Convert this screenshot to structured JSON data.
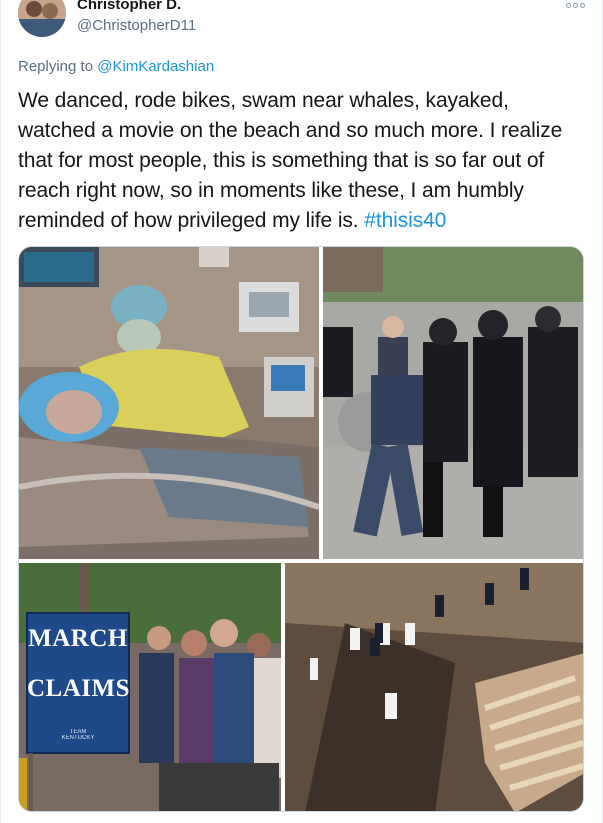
{
  "author": {
    "display_name": "Christopher D.",
    "handle": "@ChristopherD11"
  },
  "reply": {
    "prefix": "Replying to",
    "mention": "@KimKardashian"
  },
  "tweet": {
    "text": "We danced, rode bikes, swam near whales, kayaked, watched a movie on the beach and so much more. I realize that for most people, this is something that is so far out of reach right now, so in moments like these, I am humbly reminded of how privileged my life is.",
    "hashtag": "#thisis40"
  },
  "media": {
    "sign_line1": "MARCH",
    "sign_line2": "CLAIMS",
    "sign_footer1": "TEAM",
    "sign_footer2": "KENTUCKY"
  },
  "icons": {
    "more": "more-options-icon"
  },
  "colors": {
    "link": "#1b95e0",
    "secondary_text": "#5b7083",
    "primary_text": "#14171a"
  }
}
